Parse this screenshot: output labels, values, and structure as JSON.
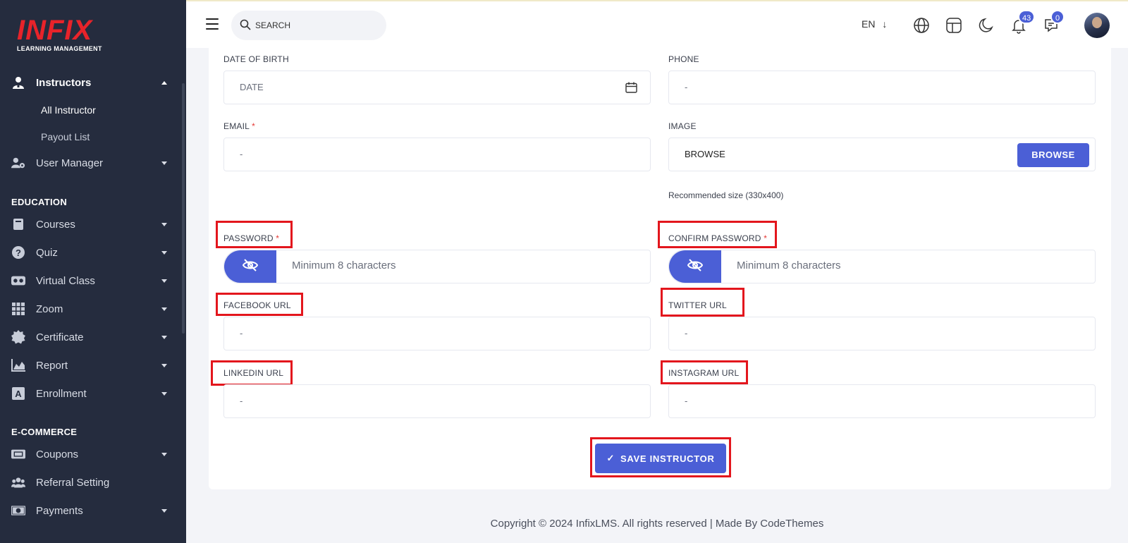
{
  "brand": {
    "logo_text": "INFIX",
    "tagline": "LEARNING MANAGEMENT",
    "color": "#e8232a"
  },
  "theme": {
    "accent": "#4b5fd6",
    "sidebar_bg": "#252c3e",
    "highlight_border": "#e3161d"
  },
  "sidebar": {
    "instructors": {
      "label": "Instructors",
      "icon": "person-icon",
      "expanded": true,
      "children": [
        {
          "label": "All Instructor",
          "active": true
        },
        {
          "label": "Payout List"
        }
      ]
    },
    "user_manager": {
      "label": "User Manager",
      "icon": "user-gear-icon"
    },
    "section_education": "EDUCATION",
    "courses": {
      "label": "Courses",
      "icon": "book-icon"
    },
    "quiz": {
      "label": "Quiz",
      "icon": "question-circle-icon"
    },
    "virtual_class": {
      "label": "Virtual Class",
      "icon": "vr-headset-icon"
    },
    "zoom": {
      "label": "Zoom",
      "icon": "grid-icon"
    },
    "certificate": {
      "label": "Certificate",
      "icon": "certificate-icon"
    },
    "report": {
      "label": "Report",
      "icon": "chart-area-icon"
    },
    "enrollment": {
      "label": "Enrollment",
      "icon": "enrollment-icon"
    },
    "section_ecommerce": "E-COMMERCE",
    "coupons": {
      "label": "Coupons",
      "icon": "ticket-icon"
    },
    "referral": {
      "label": "Referral Setting",
      "icon": "users-icon"
    },
    "payments": {
      "label": "Payments",
      "icon": "money-icon"
    }
  },
  "header": {
    "search_placeholder": "SEARCH",
    "language": "EN",
    "notifications_count": "43",
    "messages_count": "0"
  },
  "form": {
    "dob": {
      "label": "DATE OF BIRTH",
      "placeholder": "DATE"
    },
    "phone": {
      "label": "PHONE",
      "value": "-"
    },
    "email": {
      "label": "EMAIL",
      "required_mark": "*",
      "value": "-"
    },
    "image": {
      "label": "IMAGE",
      "value": "BROWSE",
      "button": "BROWSE",
      "hint": "Recommended size (330x400)"
    },
    "password": {
      "label": "PASSWORD",
      "required_mark": "*",
      "placeholder": "Minimum 8 characters"
    },
    "confirm_password": {
      "label": "CONFIRM PASSWORD",
      "required_mark": "*",
      "placeholder": "Minimum 8 characters"
    },
    "facebook": {
      "label": "FACEBOOK URL",
      "value": "-"
    },
    "twitter": {
      "label": "TWITTER URL",
      "value": "-"
    },
    "linkedin": {
      "label": "LINKEDIN URL",
      "value": "-"
    },
    "instagram": {
      "label": "INSTAGRAM URL",
      "value": "-"
    },
    "save_button": "SAVE INSTRUCTOR",
    "save_icon": "check-icon"
  },
  "footer": {
    "text": "Copyright © 2024 InfixLMS. All rights reserved | Made By CodeThemes"
  }
}
